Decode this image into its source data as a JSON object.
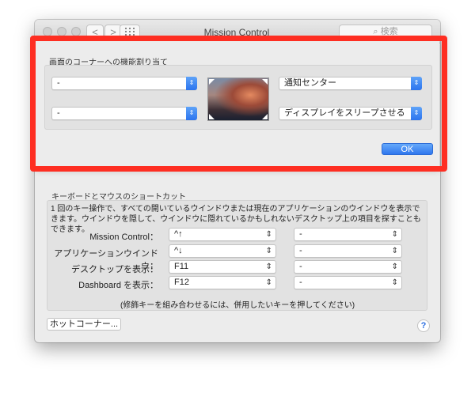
{
  "window": {
    "title": "Mission Control",
    "search_placeholder": "検索",
    "back": "<",
    "forward": ">",
    "grid": "⠿"
  },
  "sheet": {
    "section_title": "画面のコーナーへの機能割り当て",
    "top_left": "-",
    "bottom_left": "-",
    "top_right": "通知センター",
    "bottom_right": "ディスプレイをスリープさせる",
    "ok_label": "OK"
  },
  "shortcuts": {
    "section_title": "キーボードとマウスのショートカット",
    "description": "1 回のキー操作で、すべての開いているウインドウまたは現在のアプリケーションのウインドウを表示できます。ウインドウを隠して、ウインドウに隠れているかもしれないデスクトップ上の項目を探すこともできます。",
    "rows": [
      {
        "label": "Mission Control：",
        "key": "^↑",
        "mouse": "-"
      },
      {
        "label": "アプリケーションウインドウ：",
        "key": "^↓",
        "mouse": "-"
      },
      {
        "label": "デスクトップを表示：",
        "key": "F11",
        "mouse": "-"
      },
      {
        "label": "Dashboard を表示：",
        "key": "F12",
        "mouse": "-"
      }
    ],
    "footnote": "(修飾キーを組み合わせるには、併用したいキーを押してください)"
  },
  "footer": {
    "hot_corners_label": "ホットコーナー...",
    "help_label": "?"
  },
  "colors": {
    "accent": "#2f76ee",
    "highlight_frame": "#fe2e22",
    "window_bg": "#ececec"
  },
  "icons": {
    "popup_arrow": "chevron-updown-icon",
    "help": "help-icon"
  }
}
